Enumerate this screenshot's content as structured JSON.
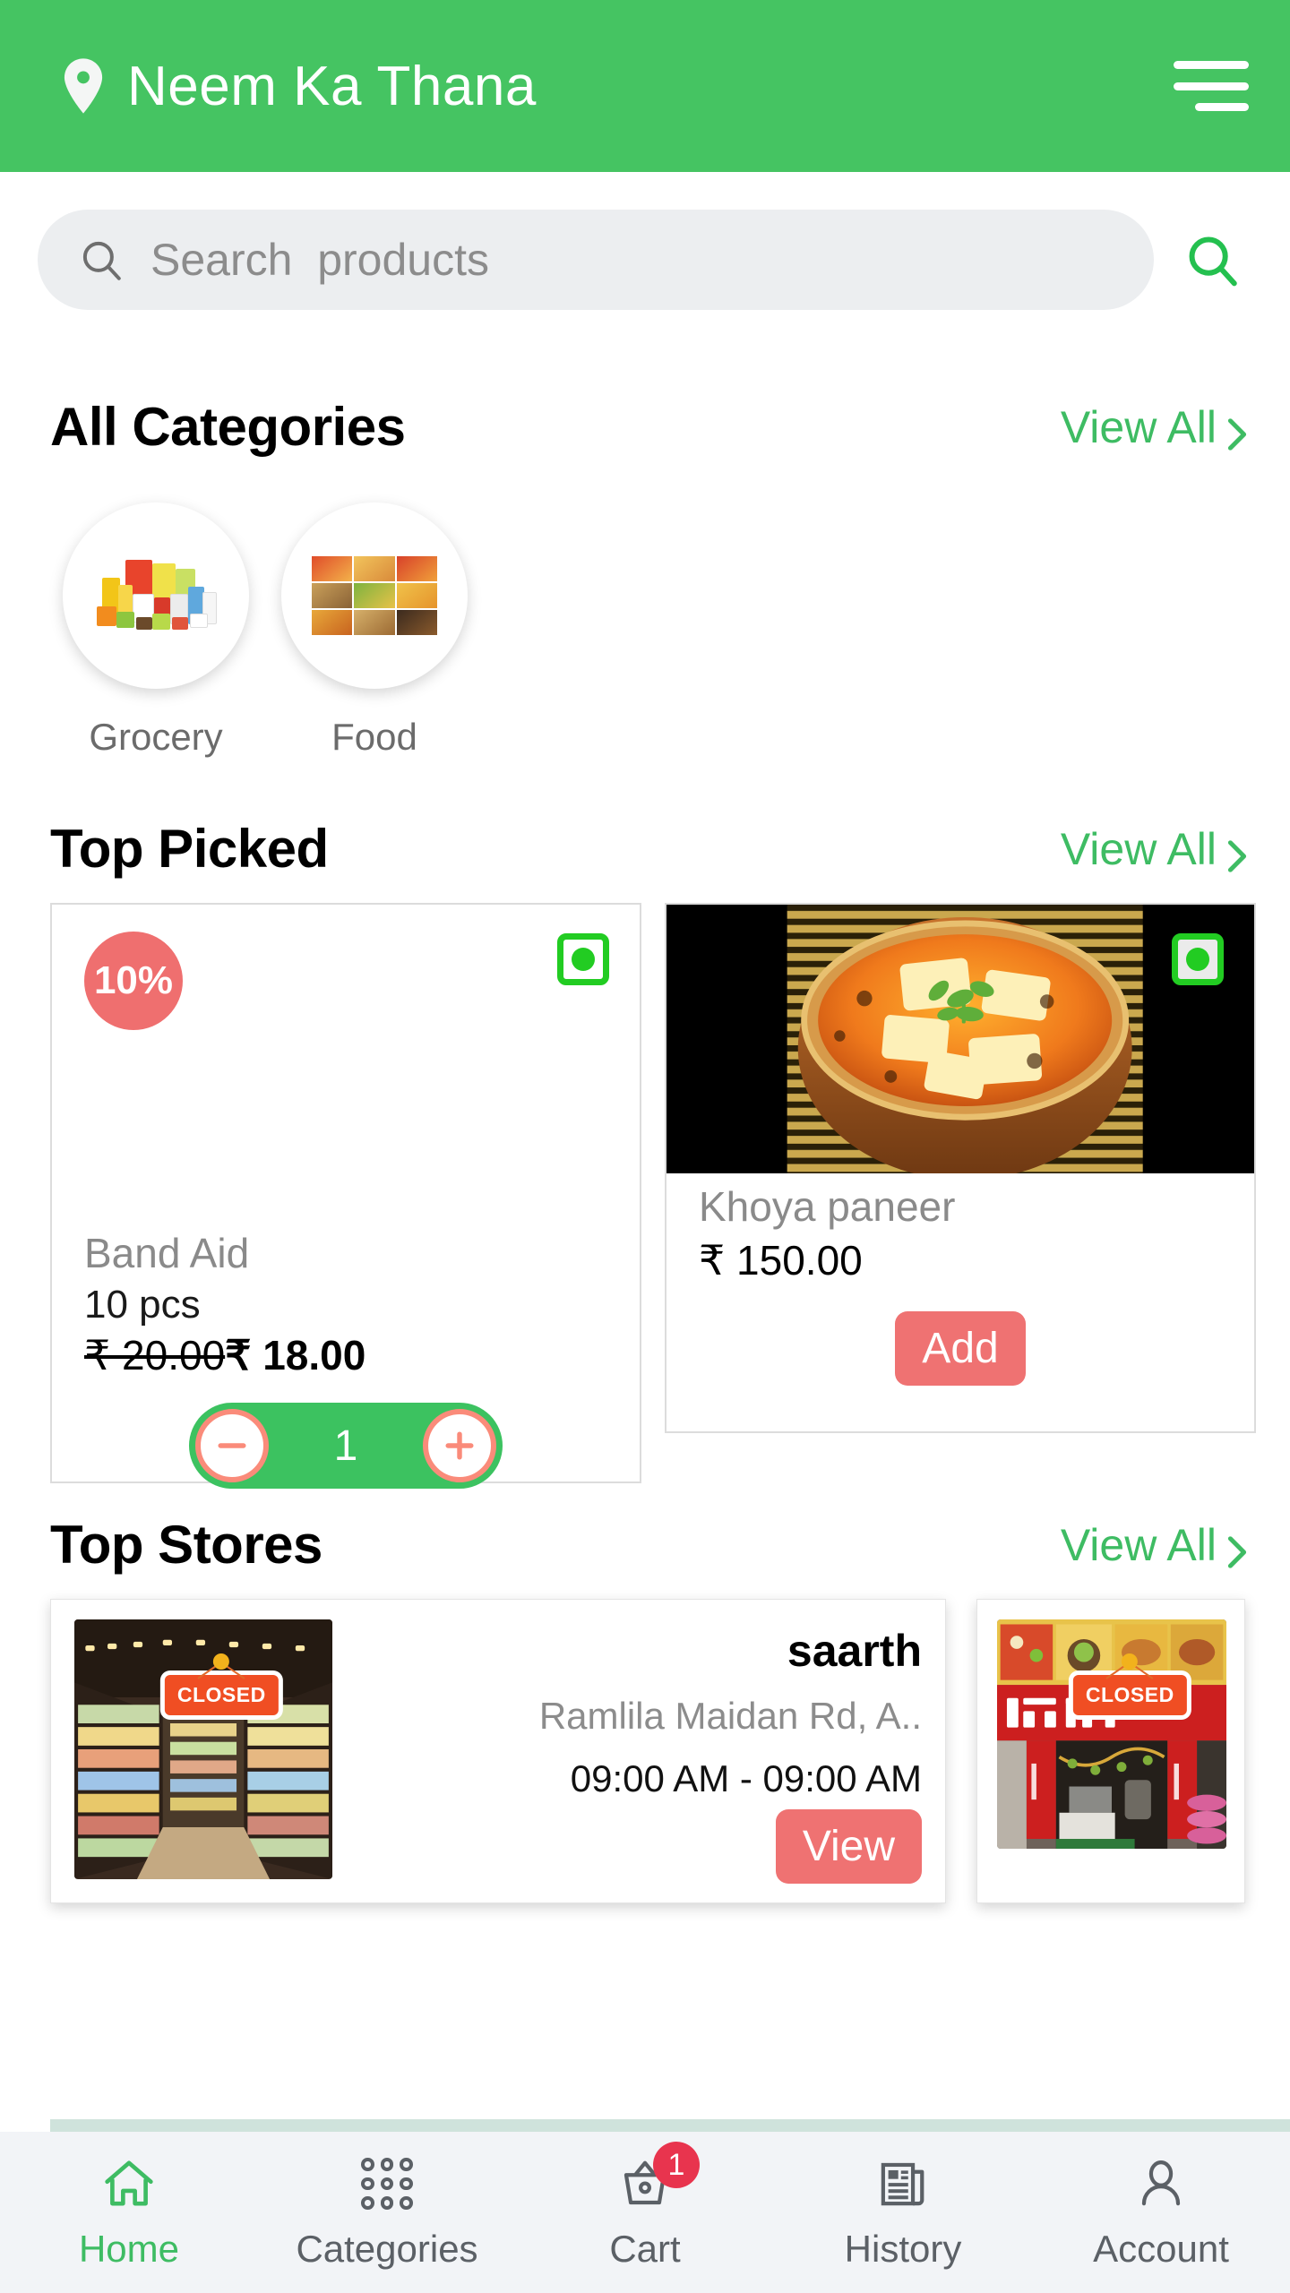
{
  "header": {
    "location_title": "Neem Ka Thana",
    "pin_icon": "location-pin-icon",
    "menu_icon": "hamburger-menu-icon"
  },
  "search": {
    "placeholder": "Search  products",
    "left_icon": "search-icon",
    "submit_icon": "search-icon"
  },
  "sections": {
    "categories": {
      "title": "All Categories",
      "view_all": "View All",
      "items": [
        {
          "label": "Grocery",
          "image": "grocery-products-collage"
        },
        {
          "label": "Food",
          "image": "food-dishes-grid"
        }
      ]
    },
    "top_picked": {
      "title": "Top Picked",
      "view_all": "View All",
      "products": [
        {
          "name": "Band Aid",
          "unit": "10 pcs",
          "discount_badge": "10%",
          "price_old": "₹ 20.00",
          "price_new": "₹ 18.00",
          "veg_mark": "veg-indicator-icon",
          "quantity": "1",
          "image": "none"
        },
        {
          "name": "Khoya paneer",
          "price": "₹ 150.00",
          "veg_mark": "veg-indicator-icon",
          "add_label": "Add",
          "image": "paneer-curry-bowl-photo"
        }
      ]
    },
    "top_stores": {
      "title": "Top Stores",
      "view_all": "View All",
      "stores": [
        {
          "name": "saarth",
          "address": "Ramlila Maidan Rd, A..",
          "hours": "09:00 AM - 09:00 AM",
          "status_tag": "CLOSED",
          "view_label": "View",
          "image": "supermarket-aisle-photo"
        },
        {
          "status_tag": "CLOSED",
          "image": "kanha-fast-food-storefront-photo"
        }
      ]
    }
  },
  "bottom_nav": {
    "items": [
      {
        "label": "Home",
        "icon": "home-icon",
        "active": true
      },
      {
        "label": "Categories",
        "icon": "grid-dots-icon",
        "active": false
      },
      {
        "label": "Cart",
        "icon": "basket-icon",
        "active": false,
        "badge": "1"
      },
      {
        "label": "History",
        "icon": "newspaper-icon",
        "active": false
      },
      {
        "label": "Account",
        "icon": "person-icon",
        "active": false
      }
    ]
  },
  "colors": {
    "brand_green": "#45c462",
    "accent_green": "#3ebc63",
    "salmon": "#ef7272",
    "badge_red": "#e8344e",
    "veg_green": "#22cc22"
  }
}
